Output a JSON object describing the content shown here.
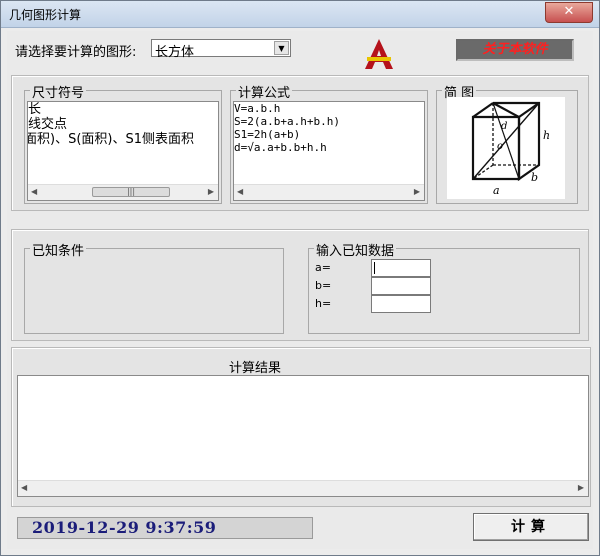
{
  "window": {
    "title": "几何图形计算",
    "close_glyph": "✕"
  },
  "shape_select": {
    "label": "请选择要计算的图形:",
    "value": "长方体"
  },
  "about_button": {
    "label": "关于本软件"
  },
  "symbols": {
    "title": "尺寸符号",
    "lines": [
      "长",
      "线交点",
      "面积)、S(面积)、S1侧表面积"
    ]
  },
  "formula": {
    "title": "计算公式",
    "lines": [
      "V=a.b.h",
      "S=2(a.b+a.h+b.h)",
      "S1=2h(a+b)",
      "d=√a.a+b.b+h.h"
    ]
  },
  "diagram": {
    "title": "简  图",
    "labels": {
      "h": "h",
      "b": "b",
      "a": "a",
      "o": "o",
      "d": "d"
    }
  },
  "known": {
    "title": "已知条件"
  },
  "input_data": {
    "title": "输入已知数据",
    "fields": [
      {
        "label": "a=",
        "value": ""
      },
      {
        "label": "b=",
        "value": ""
      },
      {
        "label": "h=",
        "value": ""
      }
    ]
  },
  "result": {
    "title": "计算结果"
  },
  "clock": {
    "text": "2019-12-29  9:37:59"
  },
  "calc_button": {
    "label": "计算"
  }
}
